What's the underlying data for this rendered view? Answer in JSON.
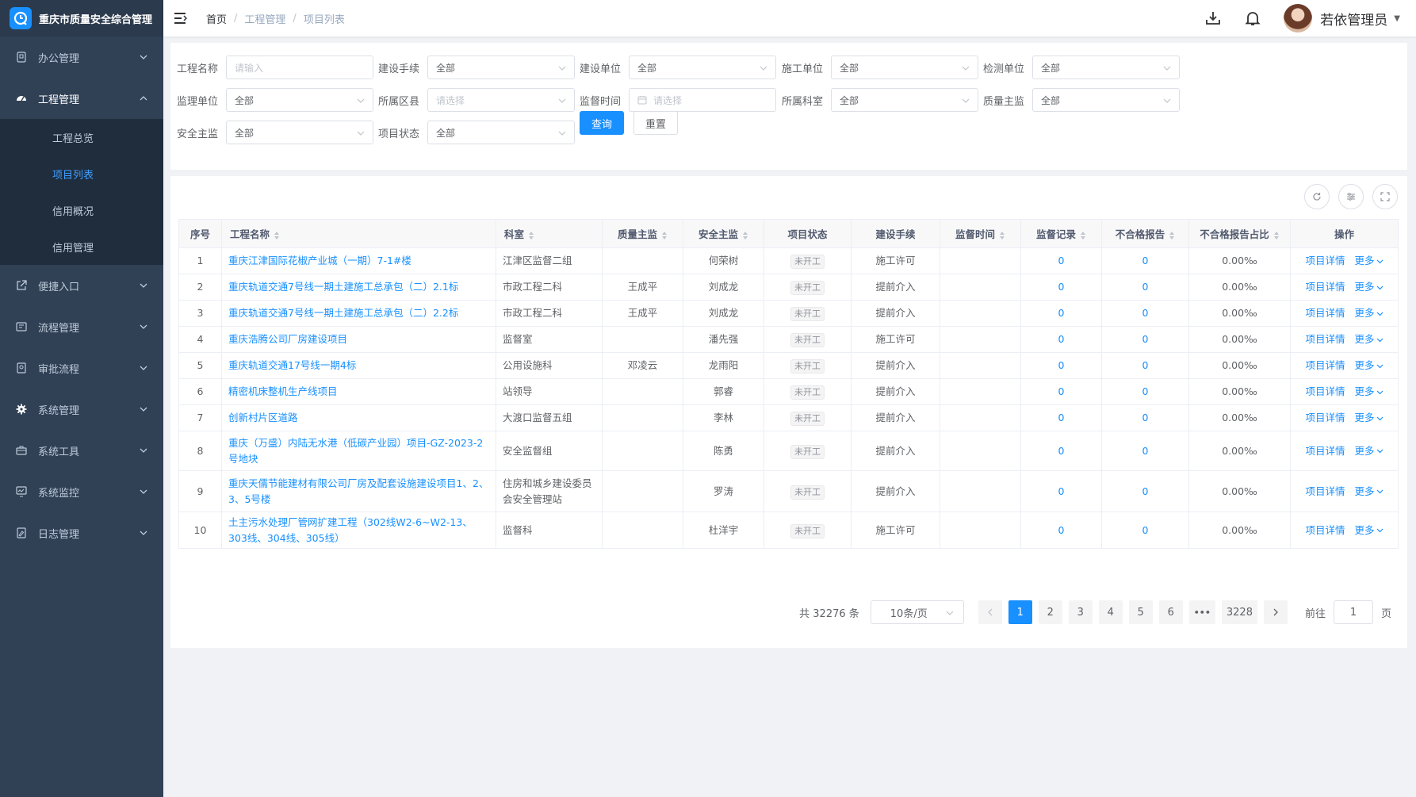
{
  "app": {
    "title": "重庆市质量安全综合管理"
  },
  "sidebar": {
    "items": [
      {
        "label": "办公管理",
        "icon": "monitor-icon",
        "open": false
      },
      {
        "label": "工程管理",
        "icon": "dashboard-icon",
        "open": true,
        "children": [
          {
            "label": "工程总览",
            "active": false
          },
          {
            "label": "项目列表",
            "active": true
          },
          {
            "label": "信用概况",
            "active": false
          },
          {
            "label": "信用管理",
            "active": false
          }
        ]
      },
      {
        "label": "便捷入口",
        "icon": "external-link-icon",
        "open": false
      },
      {
        "label": "流程管理",
        "icon": "workflow-icon",
        "open": false
      },
      {
        "label": "审批流程",
        "icon": "approval-icon",
        "open": false
      },
      {
        "label": "系统管理",
        "icon": "gear-icon",
        "open": false
      },
      {
        "label": "系统工具",
        "icon": "toolbox-icon",
        "open": false
      },
      {
        "label": "系统监控",
        "icon": "monitor-chart-icon",
        "open": false
      },
      {
        "label": "日志管理",
        "icon": "log-icon",
        "open": false
      }
    ]
  },
  "header": {
    "breadcrumb": [
      "首页",
      "工程管理",
      "项目列表"
    ],
    "username": "若依管理员"
  },
  "filters": {
    "row1": [
      {
        "label": "工程名称",
        "value": "",
        "placeholder": "请输入",
        "type": "input"
      },
      {
        "label": "建设手续",
        "value": "全部",
        "type": "select"
      },
      {
        "label": "建设单位",
        "value": "全部",
        "type": "select"
      },
      {
        "label": "施工单位",
        "value": "全部",
        "type": "select"
      },
      {
        "label": "检测单位",
        "value": "全部",
        "type": "select"
      }
    ],
    "row2": [
      {
        "label": "监理单位",
        "value": "全部",
        "type": "select"
      },
      {
        "label": "所属区县",
        "value": "",
        "placeholder": "请选择",
        "type": "select"
      },
      {
        "label": "监督时间",
        "value": "",
        "placeholder": "请选择",
        "type": "date"
      },
      {
        "label": "所属科室",
        "value": "全部",
        "type": "select"
      },
      {
        "label": "质量主监",
        "value": "全部",
        "type": "select"
      }
    ],
    "row3": [
      {
        "label": "安全主监",
        "value": "全部",
        "type": "select"
      },
      {
        "label": "项目状态",
        "value": "全部",
        "type": "select"
      }
    ],
    "query_label": "查询",
    "reset_label": "重置"
  },
  "table": {
    "columns": [
      "序号",
      "工程名称",
      "科室",
      "质量主监",
      "安全主监",
      "项目状态",
      "建设手续",
      "监督时间",
      "监督记录",
      "不合格报告",
      "不合格报告占比",
      "操作"
    ],
    "detail_label": "项目详情",
    "more_label": "更多",
    "rows": [
      {
        "index": "1",
        "name": "重庆江津国际花椒产业城（一期）7-1#楼",
        "dept": "江津区监督二组",
        "quality": "",
        "safety": "何荣树",
        "status": "未开工",
        "procedure": "施工许可",
        "time": "",
        "records": "0",
        "failed": "0",
        "ratio": "0.00‰"
      },
      {
        "index": "2",
        "name": "重庆轨道交通7号线一期土建施工总承包（二）2.1标",
        "dept": "市政工程二科",
        "quality": "王成平",
        "safety": "刘成龙",
        "status": "未开工",
        "procedure": "提前介入",
        "time": "",
        "records": "0",
        "failed": "0",
        "ratio": "0.00‰"
      },
      {
        "index": "3",
        "name": "重庆轨道交通7号线一期土建施工总承包（二）2.2标",
        "dept": "市政工程二科",
        "quality": "王成平",
        "safety": "刘成龙",
        "status": "未开工",
        "procedure": "提前介入",
        "time": "",
        "records": "0",
        "failed": "0",
        "ratio": "0.00‰"
      },
      {
        "index": "4",
        "name": "重庆浩腾公司厂房建设项目",
        "dept": "监督室",
        "quality": "",
        "safety": "潘先强",
        "status": "未开工",
        "procedure": "施工许可",
        "time": "",
        "records": "0",
        "failed": "0",
        "ratio": "0.00‰"
      },
      {
        "index": "5",
        "name": "重庆轨道交通17号线一期4标",
        "dept": "公用设施科",
        "quality": "邓凌云",
        "safety": "龙雨阳",
        "status": "未开工",
        "procedure": "提前介入",
        "time": "",
        "records": "0",
        "failed": "0",
        "ratio": "0.00‰"
      },
      {
        "index": "6",
        "name": "精密机床整机生产线项目",
        "dept": "站领导",
        "quality": "",
        "safety": "郭睿",
        "status": "未开工",
        "procedure": "提前介入",
        "time": "",
        "records": "0",
        "failed": "0",
        "ratio": "0.00‰"
      },
      {
        "index": "7",
        "name": "创新村片区道路",
        "dept": "大渡口监督五组",
        "quality": "",
        "safety": "李林",
        "status": "未开工",
        "procedure": "提前介入",
        "time": "",
        "records": "0",
        "failed": "0",
        "ratio": "0.00‰"
      },
      {
        "index": "8",
        "name": "重庆（万盛）内陆无水港（低碳产业园）项目-GZ-2023-2号地块",
        "dept": "安全监督组",
        "quality": "",
        "safety": "陈勇",
        "status": "未开工",
        "procedure": "提前介入",
        "time": "",
        "records": "0",
        "failed": "0",
        "ratio": "0.00‰"
      },
      {
        "index": "9",
        "name": "重庆天儒节能建材有限公司厂房及配套设施建设项目1、2、3、5号楼",
        "dept": "住房和城乡建设委员会安全管理站",
        "quality": "",
        "safety": "罗涛",
        "status": "未开工",
        "procedure": "提前介入",
        "time": "",
        "records": "0",
        "failed": "0",
        "ratio": "0.00‰"
      },
      {
        "index": "10",
        "name": "土主污水处理厂管网扩建工程（302线W2-6~W2-13、303线、304线、305线）",
        "dept": "监督科",
        "quality": "",
        "safety": "杜洋宇",
        "status": "未开工",
        "procedure": "施工许可",
        "time": "",
        "records": "0",
        "failed": "0",
        "ratio": "0.00‰"
      }
    ]
  },
  "pagination": {
    "total_text": "共 32276 条",
    "page_size": "10条/页",
    "pages": [
      "1",
      "2",
      "3",
      "4",
      "5",
      "6"
    ],
    "ellipsis": "•••",
    "last_page": "3228",
    "goto_prefix": "前往",
    "goto_value": "1",
    "goto_suffix": "页"
  },
  "colors": {
    "primary": "#1890ff",
    "sidebar_bg": "#304156",
    "sidebar_text": "#bfcbd9"
  }
}
